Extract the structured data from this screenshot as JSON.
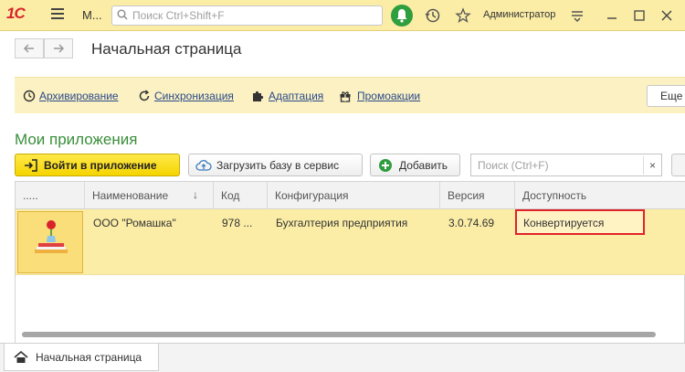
{
  "titlebar": {
    "logo_text": "1С",
    "app_title": "М...",
    "search_placeholder": "Поиск Ctrl+Shift+F",
    "username": "Администратор"
  },
  "nav": {
    "page_title": "Начальная страница"
  },
  "links": [
    {
      "label": "Архивирование",
      "icon": "clock-icon"
    },
    {
      "label": "Синхронизация",
      "icon": "refresh-icon"
    },
    {
      "label": "Адаптация",
      "icon": "puzzle-icon"
    },
    {
      "label": "Промоакции",
      "icon": "gift-icon"
    }
  ],
  "links_more": "Еще",
  "section": {
    "title": "Мои приложения",
    "login_button": "Войти в приложение",
    "upload_button": "Загрузить базу в сервис",
    "add_button": "Добавить",
    "filter_placeholder": "Поиск (Ctrl+F)",
    "filter_clear": "×"
  },
  "table": {
    "columns": [
      ".....",
      "Наименование",
      "Код",
      "Конфигурация",
      "Версия",
      "Доступность"
    ],
    "sort_indicator": "↓",
    "rows": [
      {
        "name": "ООО \"Ромашка\"",
        "code": "978 ...",
        "configuration": "Бухгалтерия предприятия",
        "version": "3.0.74.69",
        "availability": "Конвертируется"
      }
    ]
  },
  "bottom_tab": {
    "label": "Начальная страница"
  },
  "colors": {
    "titlebar_bg": "#fbeda6",
    "accent_green": "#3b8e3b",
    "primary_button": "#f5d400",
    "status_border": "#e0232b",
    "link_color": "#2a4a8a"
  }
}
